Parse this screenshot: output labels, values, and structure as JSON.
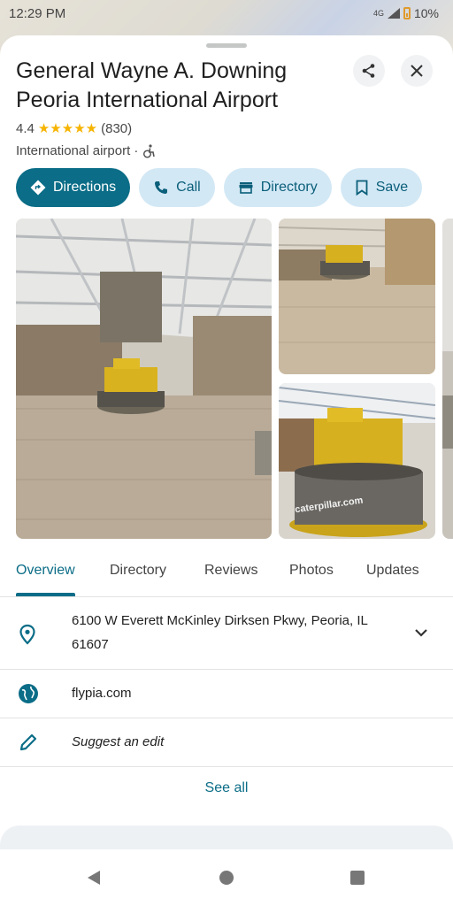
{
  "status_bar": {
    "time": "12:29 PM",
    "network": "4G",
    "battery": "10%"
  },
  "place": {
    "name": "General Wayne A. Downing Peoria International Airport",
    "rating": "4.4",
    "stars": "★★★★★",
    "reviews_count": "(830)",
    "category": "International airport · "
  },
  "actions": {
    "directions": "Directions",
    "call": "Call",
    "directory": "Directory",
    "save": "Save"
  },
  "photos": {
    "sign_text": "caterpillar.com"
  },
  "tabs": [
    "Overview",
    "Directory",
    "Reviews",
    "Photos",
    "Updates"
  ],
  "info": {
    "address_line1": "6100 W Everett McKinley Dirksen Pkwy, Peoria, IL",
    "address_line2": "61607",
    "website": "flypia.com",
    "suggest_edit": "Suggest an edit",
    "see_all": "See all"
  },
  "colors": {
    "accent": "#0b6d87",
    "chip_bg": "#d3e8f5",
    "star": "#f6b400"
  }
}
